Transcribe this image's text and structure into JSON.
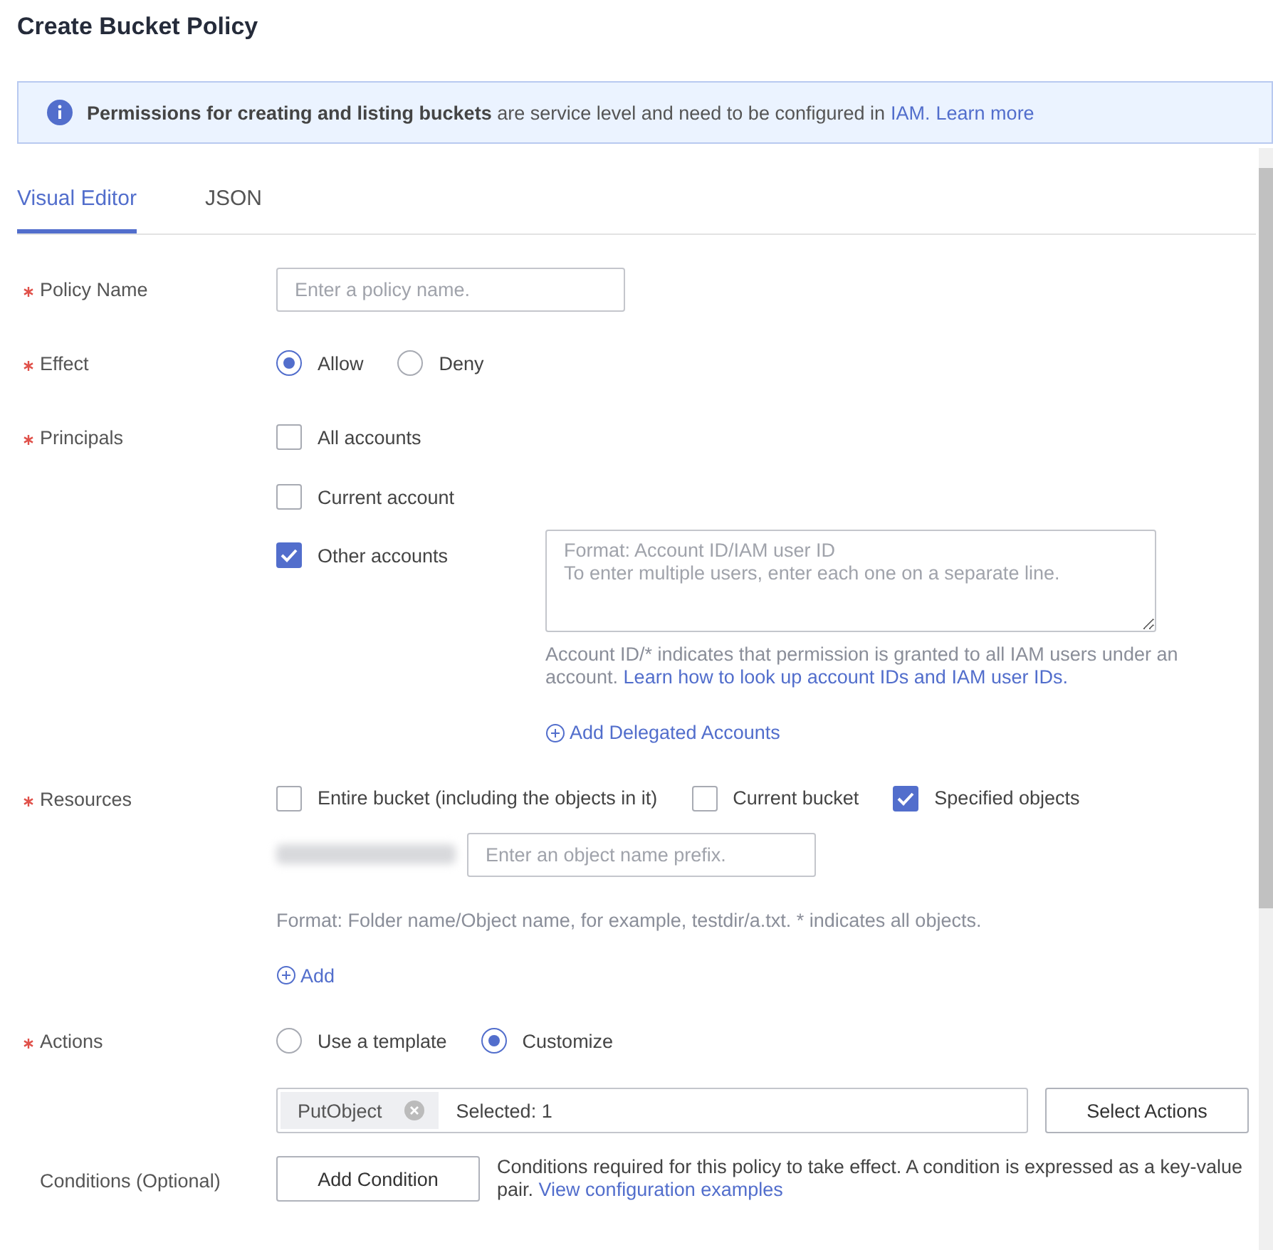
{
  "title": "Create Bucket Policy",
  "notice": {
    "text": "**Permissions for creating and listing buckets** are service level and need to be configured in",
    "links": [
      "IAM.",
      "Learn more"
    ]
  },
  "tabs": [
    {
      "label": "Visual Editor",
      "selected": true
    },
    {
      "label": "JSON",
      "selected": false
    }
  ],
  "policy_name": {
    "label": "Policy Name",
    "required": true,
    "placeholder": "Enter a policy name."
  },
  "effect": {
    "label": "Effect",
    "required": true,
    "options": [
      {
        "label": "Allow",
        "selected": true
      },
      {
        "label": "Deny",
        "selected": false
      }
    ]
  },
  "principals": {
    "label": "Principals",
    "required": true,
    "options": [
      {
        "label": "All accounts",
        "checked": false
      },
      {
        "label": "Current account",
        "checked": false
      },
      {
        "label": "Other accounts",
        "checked": true
      }
    ],
    "accounts_field": {
      "placeholder": "Format: Account ID/IAM user ID\nTo enter multiple users, enter each one on a separate line."
    },
    "hint": "Account ID/* indicates that permission is granted to all IAM users under an account.",
    "hint_link": "Learn how to look up account IDs and IAM user IDs.",
    "add_link": "Add Delegated Accounts"
  },
  "resources": {
    "label": "Resources",
    "required": true,
    "options": [
      {
        "label": "Entire bucket (including the objects in it)",
        "checked": false
      },
      {
        "label": "Current bucket",
        "checked": false
      },
      {
        "label": "Specified objects",
        "checked": true
      }
    ],
    "prefix_field": {
      "placeholder": "Enter an object name prefix."
    },
    "hint": "Format: Folder name/Object name, for example, testdir/a.txt. * indicates all objects.",
    "add_link": "Add"
  },
  "actions": {
    "label": "Actions",
    "required": true,
    "options": [
      {
        "label": "Use a template",
        "selected": false
      },
      {
        "label": "Customize",
        "selected": true
      }
    ],
    "tags": [
      "PutObject"
    ],
    "count": "Selected: 1",
    "button": "Select Actions"
  },
  "conditions": {
    "label": "Conditions (Optional)",
    "required": false,
    "button": "Add Condition",
    "text": "Conditions required for this policy to take effect. A condition is expressed as a key-value pair.",
    "link": "View configuration examples"
  }
}
